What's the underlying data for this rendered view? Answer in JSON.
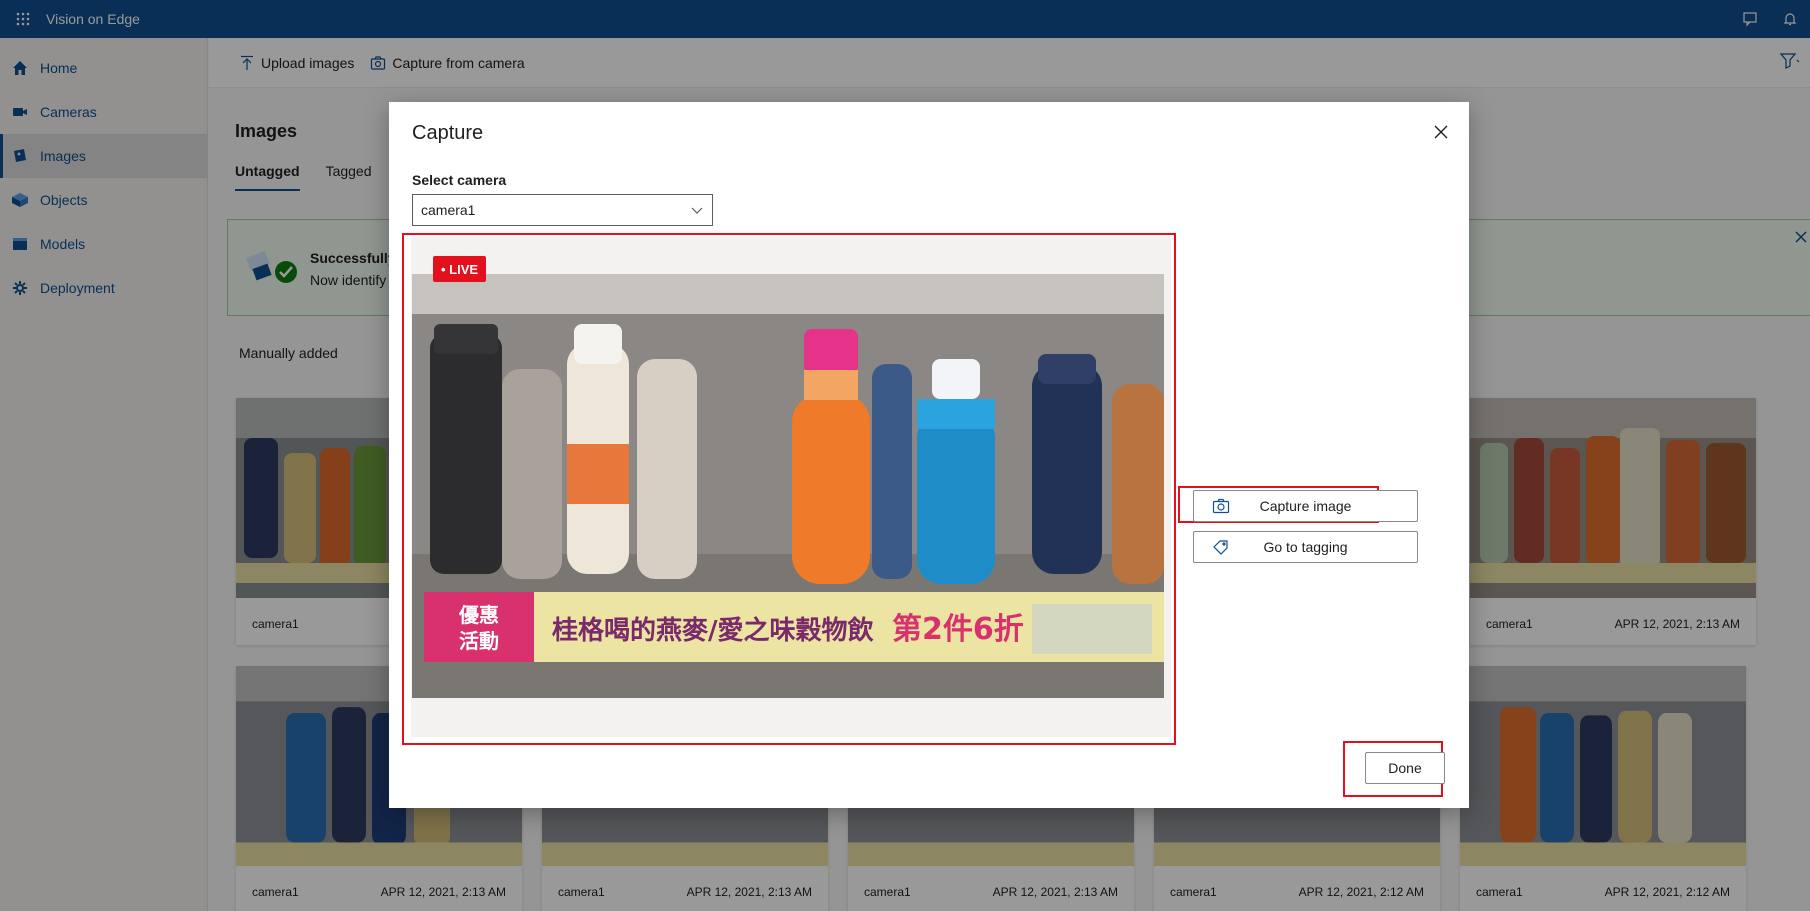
{
  "app": {
    "title": "Vision on Edge"
  },
  "sidebar": {
    "items": [
      {
        "label": "Home",
        "icon": "home-icon"
      },
      {
        "label": "Cameras",
        "icon": "camera-icon"
      },
      {
        "label": "Images",
        "icon": "images-icon",
        "active": true
      },
      {
        "label": "Objects",
        "icon": "objects-icon"
      },
      {
        "label": "Models",
        "icon": "models-icon"
      },
      {
        "label": "Deployment",
        "icon": "deployment-icon"
      }
    ]
  },
  "commandbar": {
    "upload_label": "Upload images",
    "capture_label": "Capture from camera"
  },
  "main": {
    "title": "Images",
    "tabs": [
      {
        "label": "Untagged",
        "active": true
      },
      {
        "label": "Tagged"
      }
    ],
    "banner": {
      "title": "Successfully",
      "text": "Now identify"
    },
    "section_label": "Manually added",
    "cards": [
      {
        "camera": "camera1",
        "time": ""
      },
      {
        "camera": "camera1",
        "time": "APR 12, 2021, 2:13 AM"
      },
      {
        "camera": "camera1",
        "time": "APR 12, 2021, 2:13 AM"
      },
      {
        "camera": "camera1",
        "time": "APR 12, 2021, 2:13 AM"
      },
      {
        "camera": "camera1",
        "time": "APR 12, 2021, 2:13 AM"
      },
      {
        "camera": "camera1",
        "time": "APR 12, 2021, 2:12 AM"
      },
      {
        "camera": "camera1",
        "time": "APR 12, 2021, 2:12 AM"
      }
    ]
  },
  "dialog": {
    "title": "Capture",
    "select_label": "Select camera",
    "select_value": "camera1",
    "live_label": "• LIVE",
    "video": {
      "shelf_sign_left": "優惠活動",
      "shelf_sign_main": "桂格喝的燕麥/愛之味穀物飲",
      "shelf_sign_promo": "第2件6折"
    },
    "capture_button": "Capture image",
    "tagging_button": "Go to tagging",
    "done_button": "Done"
  },
  "colors": {
    "brand": "#0f4f8f",
    "highlight": "#e3101e",
    "success": "#107c10"
  }
}
